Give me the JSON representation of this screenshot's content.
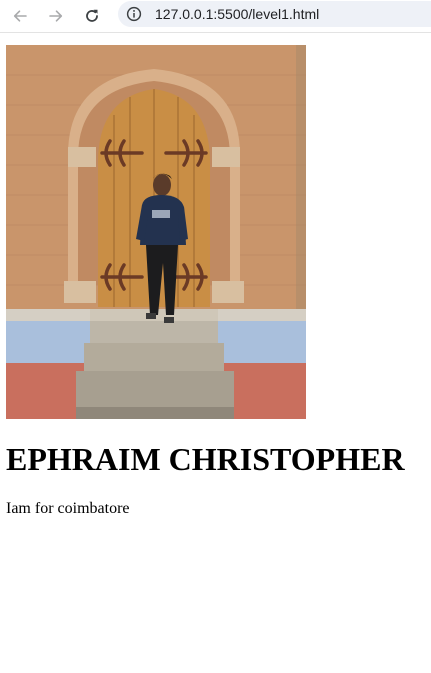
{
  "browser": {
    "url": "127.0.0.1:5500/level1.html",
    "icons": {
      "back": "arrow-left-icon",
      "forward": "arrow-right-icon",
      "reload": "reload-icon",
      "site_info": "info-icon"
    }
  },
  "page": {
    "image": {
      "subject": "photo-person-in-front-of-arched-door"
    },
    "heading": "EPHRAIM CHRISTOPHER",
    "paragraph": "Iam for coimbatore"
  },
  "colors": {
    "toolbar_bg": "#ffffff",
    "omnibox_bg": "#eef1f7",
    "icon_disabled": "#a9aaac",
    "icon_active": "#3c4043",
    "text": "#000000"
  }
}
